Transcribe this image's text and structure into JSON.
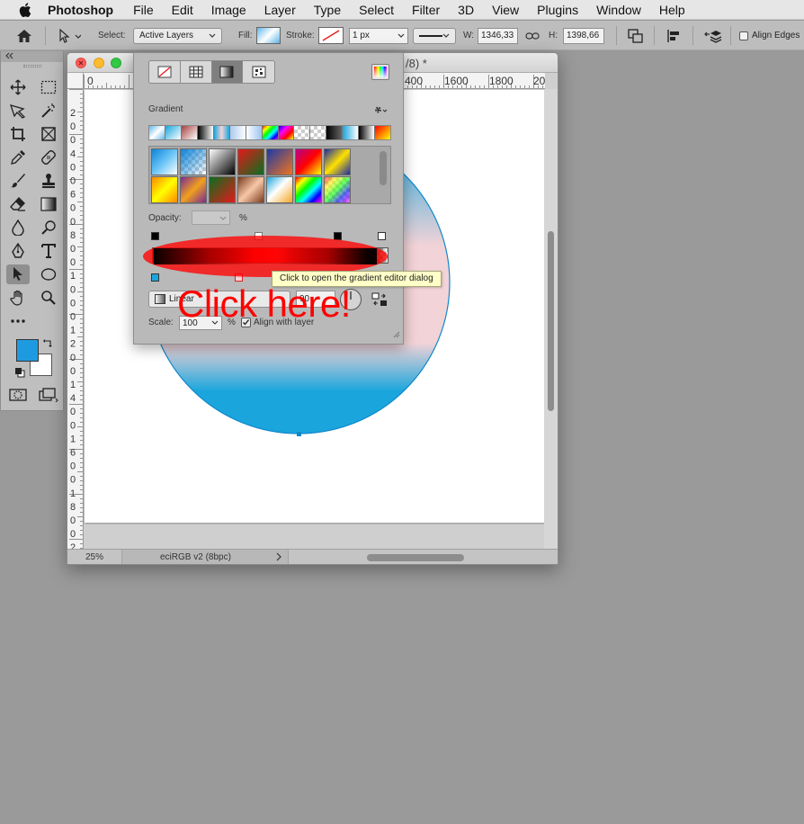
{
  "menubar": {
    "app_name": "Photoshop",
    "items": [
      "File",
      "Edit",
      "Image",
      "Layer",
      "Type",
      "Select",
      "Filter",
      "3D",
      "View",
      "Plugins",
      "Window",
      "Help"
    ]
  },
  "options_bar": {
    "select_label": "Select:",
    "select_value": "Active Layers",
    "fill_label": "Fill:",
    "stroke_label": "Stroke:",
    "stroke_width": "1 px",
    "w_label": "W:",
    "w_value": "1346,33",
    "h_label": "H:",
    "h_value": "1398,66",
    "align_edges_label": "Align Edges"
  },
  "document": {
    "title_suffix": "/8) *",
    "ruler_h_labels": [
      "0",
      "400",
      "1600",
      "1800",
      "20"
    ],
    "ruler_v_labels": [
      "2",
      "0",
      "0",
      "4",
      "0",
      "0",
      "6",
      "0",
      "0",
      "8",
      "0",
      "0",
      "1",
      "0",
      "0",
      "0",
      "1",
      "2",
      "0",
      "0",
      "1",
      "4",
      "0",
      "0",
      "1",
      "6",
      "0",
      "0",
      "1",
      "8",
      "0",
      "0",
      "2"
    ],
    "zoom": "25%",
    "doc_info": "eciRGB v2 (8bpc)",
    "circle_fill_colors": [
      "#1aa6dc",
      "#f2d3d7",
      "#ffffff"
    ],
    "circle_stroke": "#1188cc"
  },
  "toolbox": {
    "foreground_color": "#1e9be0",
    "background_color": "#ffffff"
  },
  "gradient_panel": {
    "section_title": "Gradient",
    "opacity_label": "Opacity:",
    "opacity_unit": "%",
    "gradient_type": "Linear",
    "angle_value": "90",
    "scale_label": "Scale:",
    "scale_value": "100",
    "scale_unit": "%",
    "align_with_layer_label": "Align with layer",
    "align_with_layer_checked": true,
    "gradient_stops_colors": [
      "#000000",
      "#ff0000",
      "#000000"
    ]
  },
  "tooltip": {
    "text": "Click to open the gradient editor dialog"
  },
  "annotation": {
    "text": "Click here!",
    "color": "#ff0000"
  }
}
